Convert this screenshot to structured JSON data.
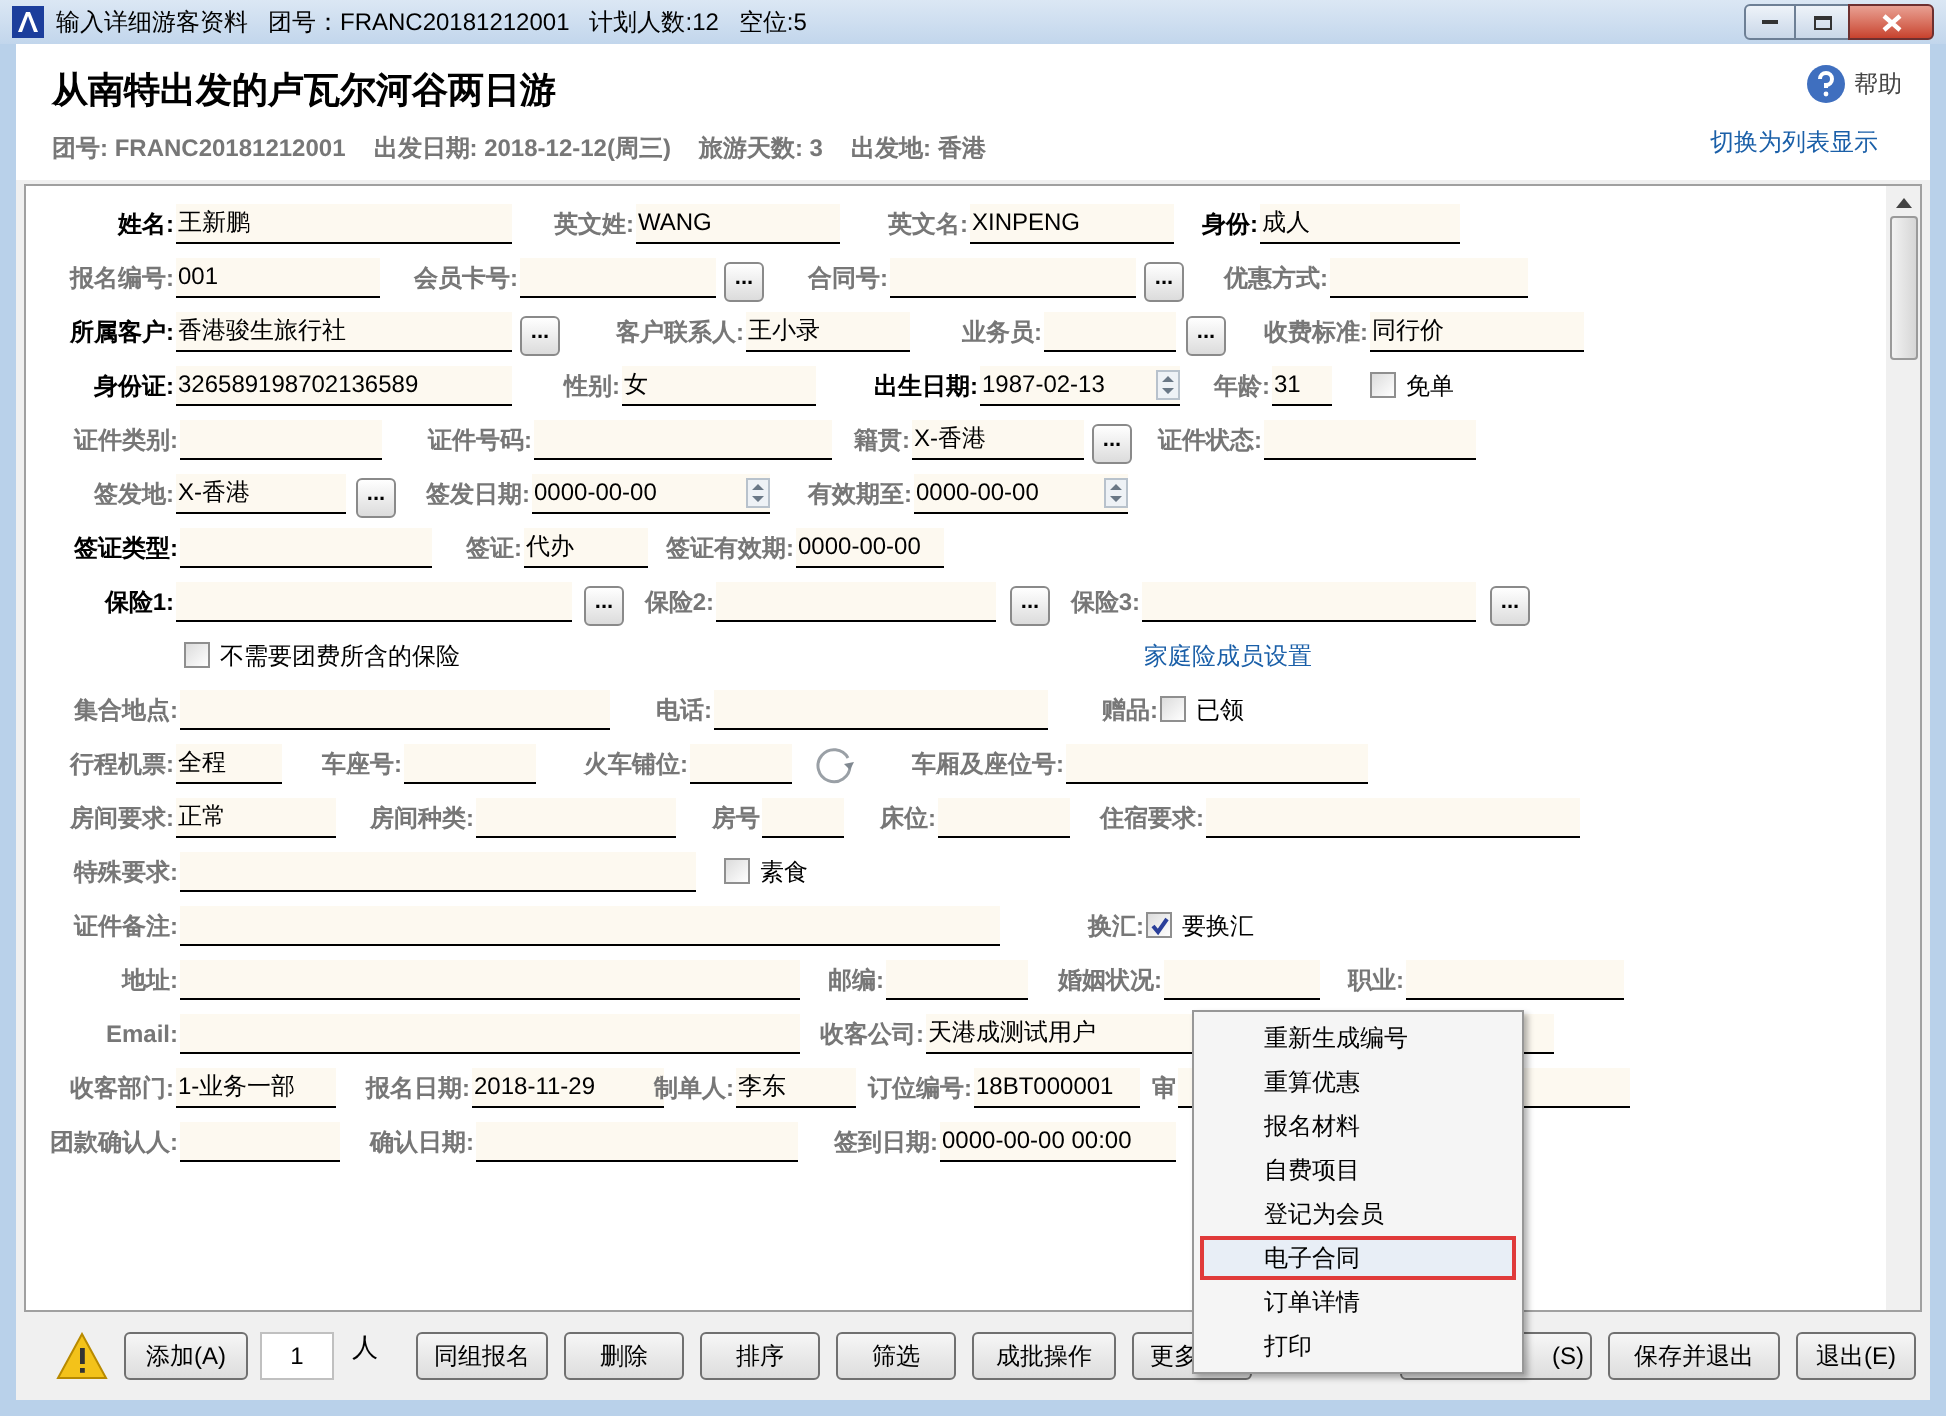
{
  "window": {
    "title": "输入详细游客资料   团号：FRANC20181212001   计划人数:12   空位:5"
  },
  "header": {
    "title": "从南特出发的卢瓦尔河谷两日游",
    "info": [
      "团号: FRANC20181212001",
      "出发日期: 2018-12-12(周三)",
      "旅游天数: 3",
      "出发地: 香港"
    ],
    "help": "帮助",
    "switch_link": "切换为列表显示"
  },
  "form": {
    "rows": [
      {
        "items": [
          {
            "kind": "field",
            "label": "姓名:",
            "value": "王新鹏",
            "required": true
          },
          {
            "kind": "field",
            "label": "英文姓:",
            "value": "WANG",
            "required": false
          },
          {
            "kind": "field",
            "label": "英文名:",
            "value": "XINPENG",
            "required": false
          },
          {
            "kind": "field",
            "label": "身份:",
            "value": "成人",
            "required": true
          }
        ]
      },
      {
        "items": [
          {
            "kind": "field",
            "label": "报名编号:",
            "value": "001",
            "required": false
          },
          {
            "kind": "field",
            "label": "会员卡号:",
            "value": "",
            "required": false
          },
          {
            "kind": "browse",
            "text": "..."
          },
          {
            "kind": "field",
            "label": "合同号:",
            "value": "",
            "required": false
          },
          {
            "kind": "browse",
            "text": "..."
          },
          {
            "kind": "field",
            "label": "优惠方式:",
            "value": "",
            "required": false
          }
        ]
      },
      {
        "items": [
          {
            "kind": "field",
            "label": "所属客户:",
            "value": "香港骏生旅行社",
            "required": true
          },
          {
            "kind": "browse",
            "text": "..."
          },
          {
            "kind": "field",
            "label": "客户联系人:",
            "value": "王小录",
            "required": false
          },
          {
            "kind": "field",
            "label": "业务员:",
            "value": "",
            "required": false
          },
          {
            "kind": "browse",
            "text": "..."
          },
          {
            "kind": "field",
            "label": "收费标准:",
            "value": "同行价",
            "required": false
          }
        ]
      },
      {
        "items": [
          {
            "kind": "field",
            "label": "身份证:",
            "value": "326589198702136589",
            "required": true
          },
          {
            "kind": "field",
            "label": "性别:",
            "value": "女",
            "required": false
          },
          {
            "kind": "date",
            "label": "出生日期:",
            "value": "1987-02-13",
            "required": true
          },
          {
            "kind": "field",
            "label": "年龄:",
            "value": "31",
            "required": false
          },
          {
            "kind": "checkbox",
            "text": "免单",
            "checked": false
          }
        ]
      },
      {
        "items": [
          {
            "kind": "field",
            "label": "证件类别:",
            "value": "",
            "required": false
          },
          {
            "kind": "field",
            "label": "证件号码:",
            "value": "",
            "required": false
          },
          {
            "kind": "field",
            "label": "籍贯:",
            "value": "X-香港",
            "required": false
          },
          {
            "kind": "browse",
            "text": "..."
          },
          {
            "kind": "field",
            "label": "证件状态:",
            "value": "",
            "required": false
          }
        ]
      },
      {
        "items": [
          {
            "kind": "field",
            "label": "签发地:",
            "value": "X-香港",
            "required": false
          },
          {
            "kind": "browse",
            "text": "..."
          },
          {
            "kind": "date",
            "label": "签发日期:",
            "value": "0000-00-00",
            "required": false
          },
          {
            "kind": "date",
            "label": "有效期至:",
            "value": "0000-00-00",
            "required": false
          }
        ]
      },
      {
        "items": [
          {
            "kind": "field",
            "label": "签证类型:",
            "value": "",
            "required": true
          },
          {
            "kind": "field",
            "label": "签证:",
            "value": "代办",
            "required": false
          },
          {
            "kind": "field",
            "label": "签证有效期:",
            "value": "0000-00-00",
            "required": false
          }
        ]
      },
      {
        "items": [
          {
            "kind": "field",
            "label": "保险1:",
            "value": "",
            "required": true
          },
          {
            "kind": "browse",
            "text": "..."
          },
          {
            "kind": "field",
            "label": "保险2:",
            "value": "",
            "required": false
          },
          {
            "kind": "browse",
            "text": "..."
          },
          {
            "kind": "field",
            "label": "保险3:",
            "value": "",
            "required": false
          },
          {
            "kind": "browse",
            "text": "..."
          }
        ]
      },
      {
        "items": [
          {
            "kind": "checkbox",
            "text": "不需要团费所含的保险",
            "checked": false
          },
          {
            "kind": "link",
            "text": "家庭险成员设置"
          }
        ]
      },
      {
        "items": [
          {
            "kind": "field",
            "label": "集合地点:",
            "value": "",
            "required": false
          },
          {
            "kind": "field",
            "label": "电话:",
            "value": "",
            "required": false
          },
          {
            "kind": "checkbox",
            "label": "赠品:",
            "text": "已领",
            "checked": false
          }
        ]
      },
      {
        "items": [
          {
            "kind": "field",
            "label": "行程机票:",
            "value": "全程",
            "required": false
          },
          {
            "kind": "field",
            "label": "车座号:",
            "value": "",
            "required": false
          },
          {
            "kind": "field",
            "label": "火车铺位:",
            "value": "",
            "required": false
          },
          {
            "kind": "refresh"
          },
          {
            "kind": "field",
            "label": "车厢及座位号:",
            "value": "",
            "required": false
          }
        ]
      },
      {
        "items": [
          {
            "kind": "field",
            "label": "房间要求:",
            "value": "正常",
            "required": false
          },
          {
            "kind": "field",
            "label": "房间种类:",
            "value": "",
            "required": false
          },
          {
            "kind": "field",
            "label": "房号",
            "value": "",
            "required": false
          },
          {
            "kind": "field",
            "label": "床位:",
            "value": "",
            "required": false
          },
          {
            "kind": "field",
            "label": "住宿要求:",
            "value": "",
            "required": false
          }
        ]
      },
      {
        "items": [
          {
            "kind": "field",
            "label": "特殊要求:",
            "value": "",
            "required": false
          },
          {
            "kind": "checkbox",
            "text": "素食",
            "checked": false
          }
        ]
      },
      {
        "items": [
          {
            "kind": "field",
            "label": "证件备注:",
            "value": "",
            "required": false
          },
          {
            "kind": "checkbox",
            "label": "换汇:",
            "text": "要换汇",
            "checked": true
          }
        ]
      },
      {
        "items": [
          {
            "kind": "field",
            "label": "地址:",
            "value": "",
            "required": false
          },
          {
            "kind": "field",
            "label": "邮编:",
            "value": "",
            "required": false
          },
          {
            "kind": "field",
            "label": "婚姻状况:",
            "value": "",
            "required": false
          },
          {
            "kind": "field",
            "label": "职业:",
            "value": "",
            "required": false
          }
        ]
      },
      {
        "items": [
          {
            "kind": "field",
            "label": "Email:",
            "value": "",
            "required": false
          },
          {
            "kind": "field",
            "label": "收客公司:",
            "value": "天港成测试用户",
            "required": false
          }
        ]
      },
      {
        "items": [
          {
            "kind": "field",
            "label": "收客部门:",
            "value": "1-业务一部",
            "required": false
          },
          {
            "kind": "field",
            "label": "报名日期:",
            "value": "2018-11-29",
            "required": false
          },
          {
            "kind": "field",
            "label": "制单人:",
            "value": "李东",
            "required": false
          },
          {
            "kind": "field",
            "label": "订位编号:",
            "value": "18BT000001",
            "required": false
          },
          {
            "kind": "field",
            "label": "审",
            "value": "",
            "required": false
          }
        ]
      },
      {
        "items": [
          {
            "kind": "field",
            "label": "团款确认人:",
            "value": "",
            "required": false
          },
          {
            "kind": "field",
            "label": "确认日期:",
            "value": "",
            "required": false
          },
          {
            "kind": "field",
            "label": "签到日期:",
            "value": "0000-00-00 00:00",
            "required": false
          }
        ]
      }
    ]
  },
  "toolbar": {
    "add": "添加(A)",
    "count": "1",
    "unit": "人",
    "buttons": [
      "同组报名",
      "删除",
      "排序",
      "筛选",
      "成批操作",
      "更多"
    ],
    "save_partial": "(S)",
    "save_exit": "保存并退出",
    "exit": "退出(E)"
  },
  "menu": {
    "items": [
      {
        "label": "重新生成编号",
        "selected": false
      },
      {
        "label": "重算优惠",
        "selected": false
      },
      {
        "label": "报名材料",
        "selected": false
      },
      {
        "label": "自费项目",
        "selected": false
      },
      {
        "label": "登记为会员",
        "selected": false
      },
      {
        "label": "电子合同",
        "selected": true
      },
      {
        "label": "订单详情",
        "selected": false
      },
      {
        "label": "打印",
        "selected": false
      }
    ]
  }
}
